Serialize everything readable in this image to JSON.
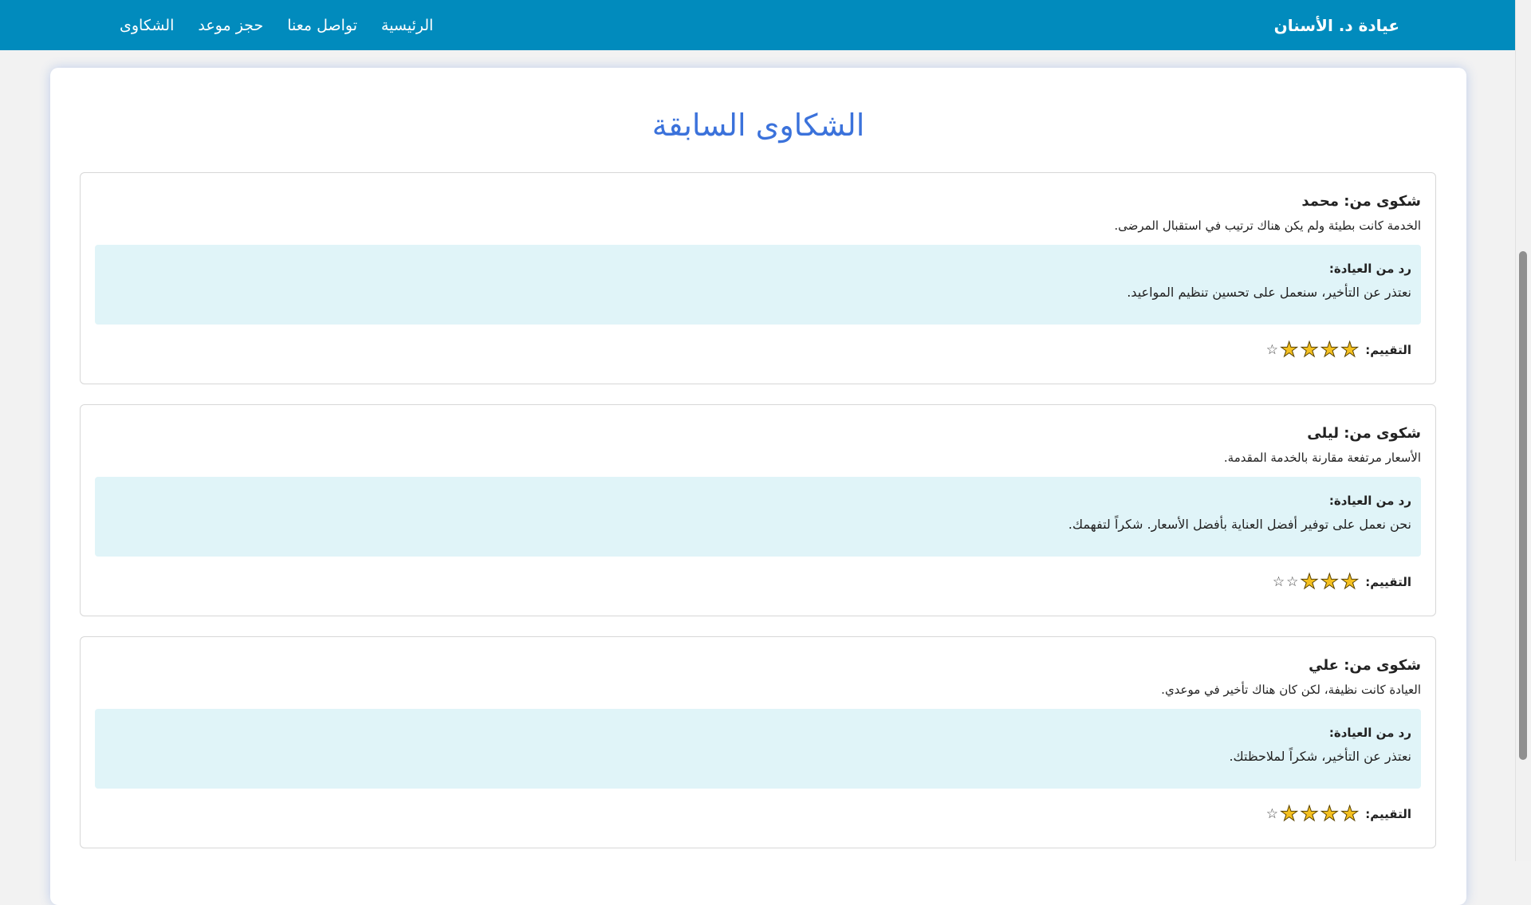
{
  "nav": {
    "brand": "عيادة د. الأسنان",
    "links": [
      "الرئيسية",
      "تواصل معنا",
      "حجز موعد",
      "الشكاوى"
    ]
  },
  "page": {
    "title": "الشكاوى السابقة"
  },
  "rating_label": "التقييم:",
  "reply_title": "رد من العيادة:",
  "complaints": [
    {
      "from": "شكوى من: محمد",
      "text": "الخدمة كانت بطيئة ولم يكن هناك ترتيب في استقبال المرضى.",
      "reply": "نعتذر عن التأخير، سنعمل على تحسين تنظيم المواعيد.",
      "rating": 4,
      "max_rating": 5
    },
    {
      "from": "شكوى من: ليلى",
      "text": "الأسعار مرتفعة مقارنة بالخدمة المقدمة.",
      "reply": "نحن نعمل على توفير أفضل العناية بأفضل الأسعار. شكراً لتفهمك.",
      "rating": 3,
      "max_rating": 5
    },
    {
      "from": "شكوى من: علي",
      "text": "العيادة كانت نظيفة، لكن كان هناك تأخير في موعدي.",
      "reply": "نعتذر عن التأخير، شكراً لملاحظتك.",
      "rating": 4,
      "max_rating": 5
    }
  ],
  "colors": {
    "navbar": "#018bbd",
    "title": "#3b72db",
    "reply_bg": "#e0f4f8",
    "star": "#f4c020"
  },
  "icons": {
    "filled_star": "star-filled-icon",
    "empty_star": "star-empty-icon"
  }
}
